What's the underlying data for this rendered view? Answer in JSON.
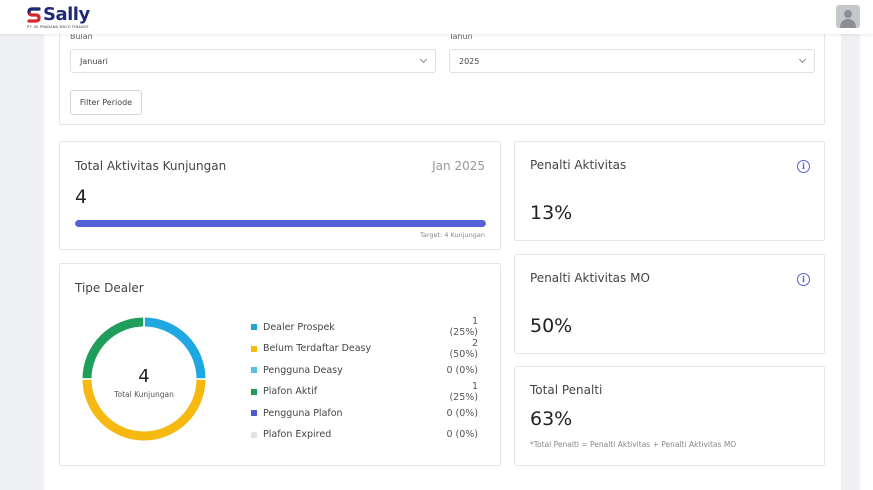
{
  "app": {
    "logo_name": "Sally",
    "logo_subtitle": "PT. SE PRADANA MULTI FINANCE"
  },
  "filters": {
    "month_label": "Bulan",
    "month_value": "Januari",
    "year_label": "Tahun",
    "year_value": "2025",
    "filter_button": "Filter Periode"
  },
  "visits_card": {
    "title": "Total Aktivitas Kunjungan",
    "period": "Jan 2025",
    "value": "4",
    "progress_fraction": 1.0,
    "target_text": "Target: 4 Kunjungan"
  },
  "penalty_card": {
    "title": "Penalti Aktivitas",
    "value": "13%"
  },
  "penalty_mo_card": {
    "title": "Penalti Aktivitas MO",
    "value": "50%"
  },
  "total_penalty_card": {
    "title": "Total Penalti",
    "value": "63%",
    "note": "*Total Penalti = Penalti Aktivitas + Penalti Aktivitas MO"
  },
  "dealer_card": {
    "title": "Tipe Dealer",
    "center_value": "4",
    "center_label": "Total Kunjungan",
    "legend": [
      {
        "label": "Dealer Prospek",
        "count": "1 (25%)",
        "color": "#1ea7e1",
        "value": 1
      },
      {
        "label": "Belum Terdaftar Deasy",
        "count": "2 (50%)",
        "color": "#f5b90f",
        "value": 2
      },
      {
        "label": "Pengguna Deasy",
        "count": "0 (0%)",
        "color": "#4fc3e0",
        "value": 0
      },
      {
        "label": "Plafon Aktif",
        "count": "1 (25%)",
        "color": "#1e9e5a",
        "value": 1
      },
      {
        "label": "Pengguna Plafon",
        "count": "0 (0%)",
        "color": "#4c5bd4",
        "value": 0
      },
      {
        "label": "Plafon Expired",
        "count": "0 (0%)",
        "color": "#e2e4e8",
        "value": 0
      }
    ]
  },
  "icons": {
    "info": "info-icon",
    "chevron": "chevron-down-icon",
    "user": "user-avatar-icon"
  }
}
